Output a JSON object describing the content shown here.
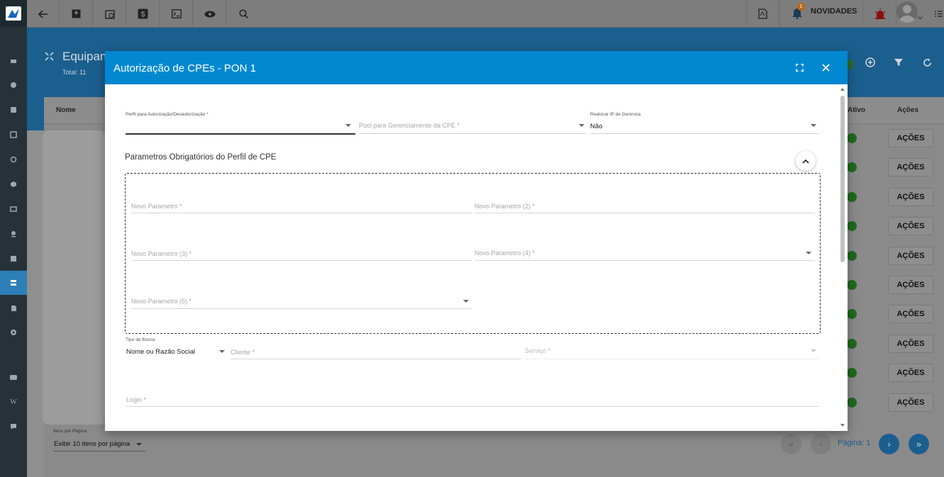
{
  "topbar": {
    "icons": [
      "back-arrow-icon",
      "contact-card-icon",
      "clock-calendar-icon",
      "dollar-icon",
      "terminal-icon",
      "eye-icon",
      "search-icon"
    ],
    "pdf_icon": "pdf-icon",
    "notification_badge": "1",
    "novidades_label": "NOVIDADES"
  },
  "sidebar": {
    "icons": [
      "dashboard-icon",
      "palette-icon",
      "contact-icon",
      "table-icon",
      "clock-icon",
      "box-icon",
      "id-card-icon",
      "location-pin-icon",
      "list-icon",
      "network-icon",
      "document-icon",
      "settings-icon",
      "youtube-icon",
      "wiki-icon",
      "chat-icon"
    ],
    "active_index": 9
  },
  "page": {
    "title": "Equipan",
    "total": "Total: 11",
    "columns": {
      "nome": "Nome",
      "ativo": "Ativo",
      "acoes": "Ações"
    },
    "row_button_label": "AÇÕES",
    "row_count": 10,
    "items_per_page_label": "Itens por Página",
    "items_per_page_value": "Exibir 10 itens por página",
    "pagination_label": "Página: 1"
  },
  "modal": {
    "title": "Autorização de CPEs - PON 1",
    "perfil_label": "Perfil para Autorização/Desautorização",
    "perfil_required": "*",
    "pool_placeholder": "Pool para Gerenciamento da CPE *",
    "realocar_label": "Realocar IP de Gerencia",
    "realocar_value": "Não",
    "section_title": "Parametros Obrigatórios do Perfil de CPE",
    "param1_placeholder": "Novo Parametro *",
    "param2_placeholder": "Novo Parametro (2) *",
    "param3_placeholder": "Novo Parametro (3) *",
    "param4_placeholder": "Novo Parametro (4) *",
    "param5_placeholder": "Novo Parametro (5) *",
    "tipo_busca_label": "Tipo de Busca",
    "tipo_busca_value": "Nome ou Razão Social",
    "cliente_placeholder": "Cliente *",
    "servico_placeholder": "Serviço *",
    "login_placeholder": "Login *"
  },
  "colors": {
    "header_blue": "#0288d1",
    "overlay_gray": "#8f8f8f",
    "sidebar_dark": "#263238"
  }
}
